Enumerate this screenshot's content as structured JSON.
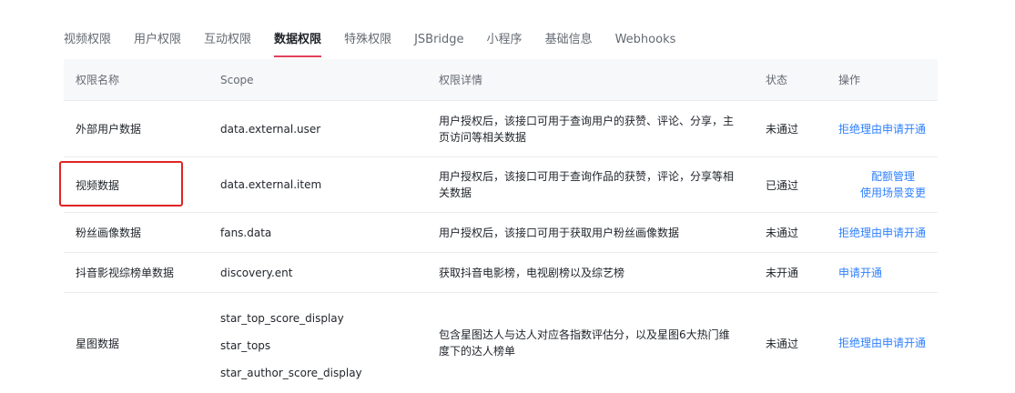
{
  "tabs": [
    {
      "label": "视频权限",
      "active": false
    },
    {
      "label": "用户权限",
      "active": false
    },
    {
      "label": "互动权限",
      "active": false
    },
    {
      "label": "数据权限",
      "active": true
    },
    {
      "label": "特殊权限",
      "active": false
    },
    {
      "label": "JSBridge",
      "active": false
    },
    {
      "label": "小程序",
      "active": false
    },
    {
      "label": "基础信息",
      "active": false
    },
    {
      "label": "Webhooks",
      "active": false
    }
  ],
  "table": {
    "headers": {
      "name": "权限名称",
      "scope": "Scope",
      "detail": "权限详情",
      "status": "状态",
      "ops": "操作"
    },
    "rows": [
      {
        "name": "外部用户数据",
        "scope": "data.external.user",
        "detail": "用户授权后，该接口可用于查询用户的获赞、评论、分享，主页访问等相关数据",
        "status": "未通过",
        "ops": [
          "拒绝理由",
          "申请开通"
        ]
      },
      {
        "name": "视频数据",
        "scope": "data.external.item",
        "detail": "用户授权后，该接口可用于查询作品的获赞，评论，分享等相关数据",
        "status": "已通过",
        "ops": [
          "配额管理",
          "使用场景变更"
        ]
      },
      {
        "name": "粉丝画像数据",
        "scope": "fans.data",
        "detail": "用户授权后，该接口可用于获取用户粉丝画像数据",
        "status": "未通过",
        "ops": [
          "拒绝理由",
          "申请开通"
        ]
      },
      {
        "name": "抖音影视综榜单数据",
        "scope": "discovery.ent",
        "detail": "获取抖音电影榜，电视剧榜以及综艺榜",
        "status": "未开通",
        "ops": [
          "申请开通"
        ]
      },
      {
        "name": "星图数据",
        "scopes": [
          "star_top_score_display",
          "star_tops",
          "star_author_score_display"
        ],
        "detail": "包含星图达人与达人对应各指数评估分，以及星图6大热门维度下的达人榜单",
        "status": "未通过",
        "ops": [
          "拒绝理由",
          "申请开通"
        ]
      }
    ]
  },
  "colors": {
    "active_tab_underline": "#e0435c",
    "link": "#2d7fff",
    "highlight_box": "#e02424"
  }
}
